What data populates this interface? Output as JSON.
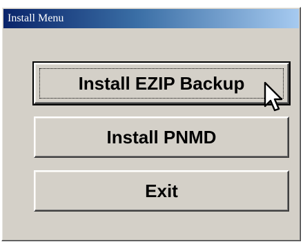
{
  "window": {
    "title": "Install Menu"
  },
  "buttons": [
    {
      "label": "Install EZIP Backup"
    },
    {
      "label": "Install PNMD"
    },
    {
      "label": "Exit"
    }
  ],
  "icons": {
    "cursor": "mouse-pointer-icon"
  }
}
